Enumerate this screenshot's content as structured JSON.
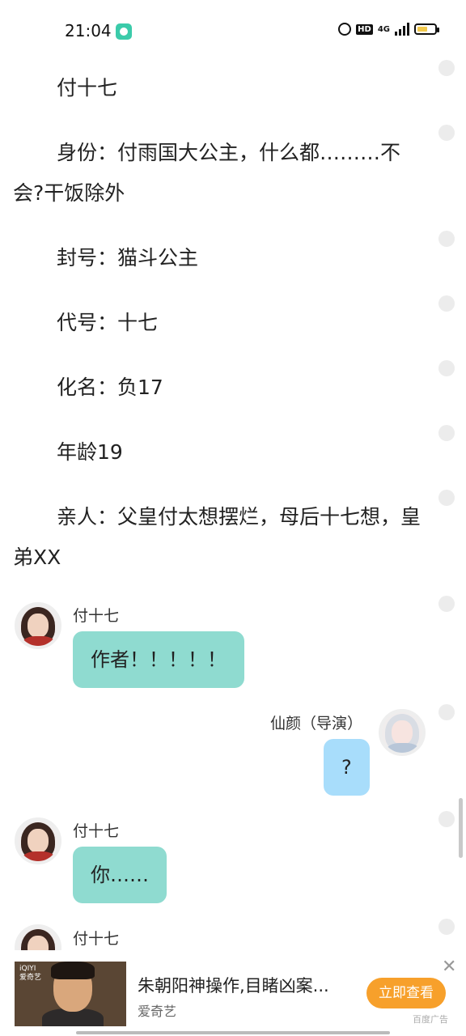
{
  "status_bar": {
    "time": "21:04",
    "hd": "HD",
    "network": "4G"
  },
  "story": {
    "paragraphs": [
      "付十七",
      "身份：付雨国大公主，什么都………不会?干饭除外",
      "封号：猫斗公主",
      "代号：十七",
      "化名：负17",
      "年龄19",
      "亲人：父皇付太想摆烂，母后十七想，皇弟XX"
    ]
  },
  "chat": [
    {
      "side": "left",
      "name": "付十七",
      "text": "作者！！！！！"
    },
    {
      "side": "right",
      "name": "仙颜（导演）",
      "text": "?"
    },
    {
      "side": "left",
      "name": "付十七",
      "text": "你……"
    },
    {
      "side": "left",
      "name": "付十七",
      "text": ""
    }
  ],
  "ad": {
    "title": "朱朝阳神操作,目睹凶案...",
    "brand": "爱奇艺",
    "button": "立即查看",
    "tag": "百度广告",
    "logo_line1": "iQIYI",
    "logo_line2": "爱奇艺",
    "close": "✕"
  },
  "colors": {
    "left_bubble": "#8fdbd0",
    "right_bubble": "#a8ddfb",
    "ad_button": "#f7a02b"
  }
}
